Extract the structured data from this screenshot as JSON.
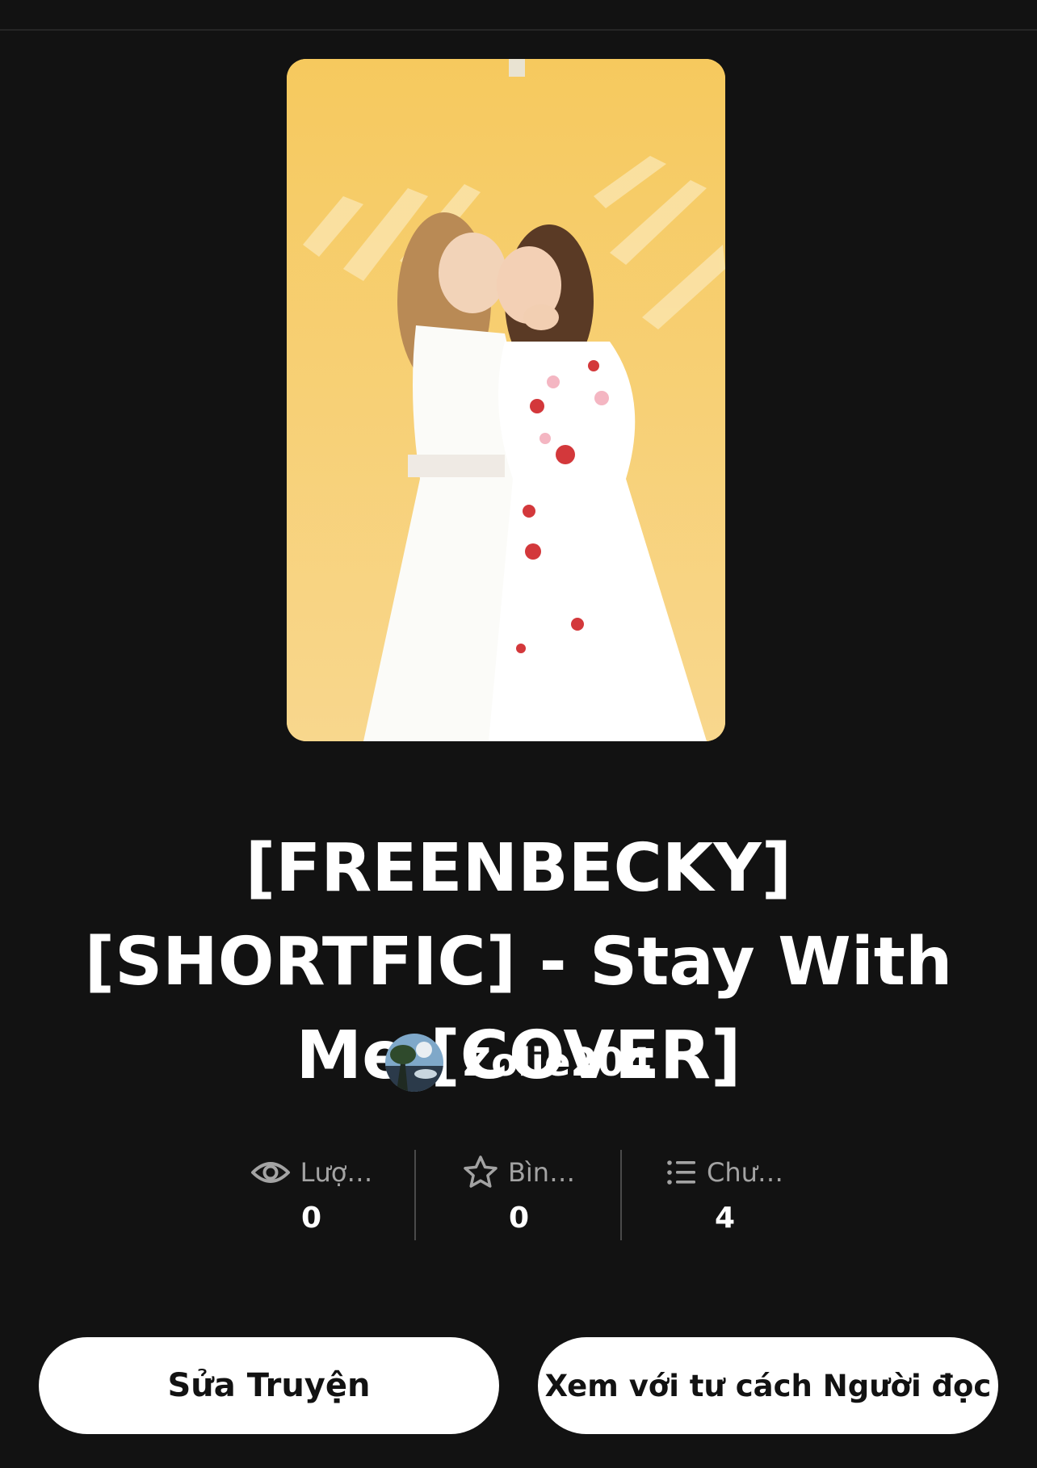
{
  "story": {
    "title": "[FREENBECKY] [SHORTFIC] - Stay With Me [COVER]",
    "cover_bg": "#f3c85c"
  },
  "author": {
    "name": "Zolie204"
  },
  "stats": [
    {
      "icon": "eye-icon",
      "label": "Lượ…",
      "value": "0"
    },
    {
      "icon": "star-icon",
      "label": "Bìn…",
      "value": "0"
    },
    {
      "icon": "list-icon",
      "label": "Chư…",
      "value": "4"
    }
  ],
  "actions": {
    "edit_label": "Sửa Truyện",
    "view_as_reader_label": "Xem với tư cách Người đọc"
  },
  "colors": {
    "background": "#121212",
    "button_bg": "#ffffff",
    "button_text": "#121212",
    "muted_text": "#a3a3a3"
  }
}
